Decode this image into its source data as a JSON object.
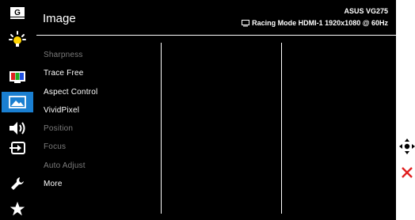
{
  "panel": {
    "title": "Image"
  },
  "header": {
    "model": "ASUS VG275",
    "status": "Racing Mode HDMI-1 1920x1080 @ 60Hz",
    "status_icon": "monitor-icon"
  },
  "sidebar": {
    "items": [
      {
        "name": "gameplus",
        "icon": "gameplus-icon",
        "label": "G",
        "active": false
      },
      {
        "name": "splendid",
        "icon": "brightness-bulb-icon",
        "active": false
      },
      {
        "name": "color",
        "icon": "color-bars-icon",
        "active": false
      },
      {
        "name": "image",
        "icon": "image-icon",
        "active": true
      },
      {
        "name": "sound",
        "icon": "speaker-icon",
        "active": false
      },
      {
        "name": "input",
        "icon": "input-select-icon",
        "active": false
      },
      {
        "name": "system",
        "icon": "wrench-icon",
        "active": false
      },
      {
        "name": "favorite",
        "icon": "star-icon",
        "active": false
      }
    ]
  },
  "menu": {
    "items": [
      {
        "label": "Sharpness",
        "enabled": false
      },
      {
        "label": "Trace Free",
        "enabled": true
      },
      {
        "label": "Aspect Control",
        "enabled": true
      },
      {
        "label": "VividPixel",
        "enabled": true
      },
      {
        "label": "Position",
        "enabled": false
      },
      {
        "label": "Focus",
        "enabled": false
      },
      {
        "label": "Auto Adjust",
        "enabled": false
      },
      {
        "label": "More",
        "enabled": true
      }
    ]
  },
  "controls": {
    "navigate_icon": "joystick-move-icon",
    "exit_icon": "close-icon"
  },
  "colors": {
    "accent": "#1a7fd1",
    "close": "#e02020",
    "dim_text": "#7c7c7c"
  }
}
